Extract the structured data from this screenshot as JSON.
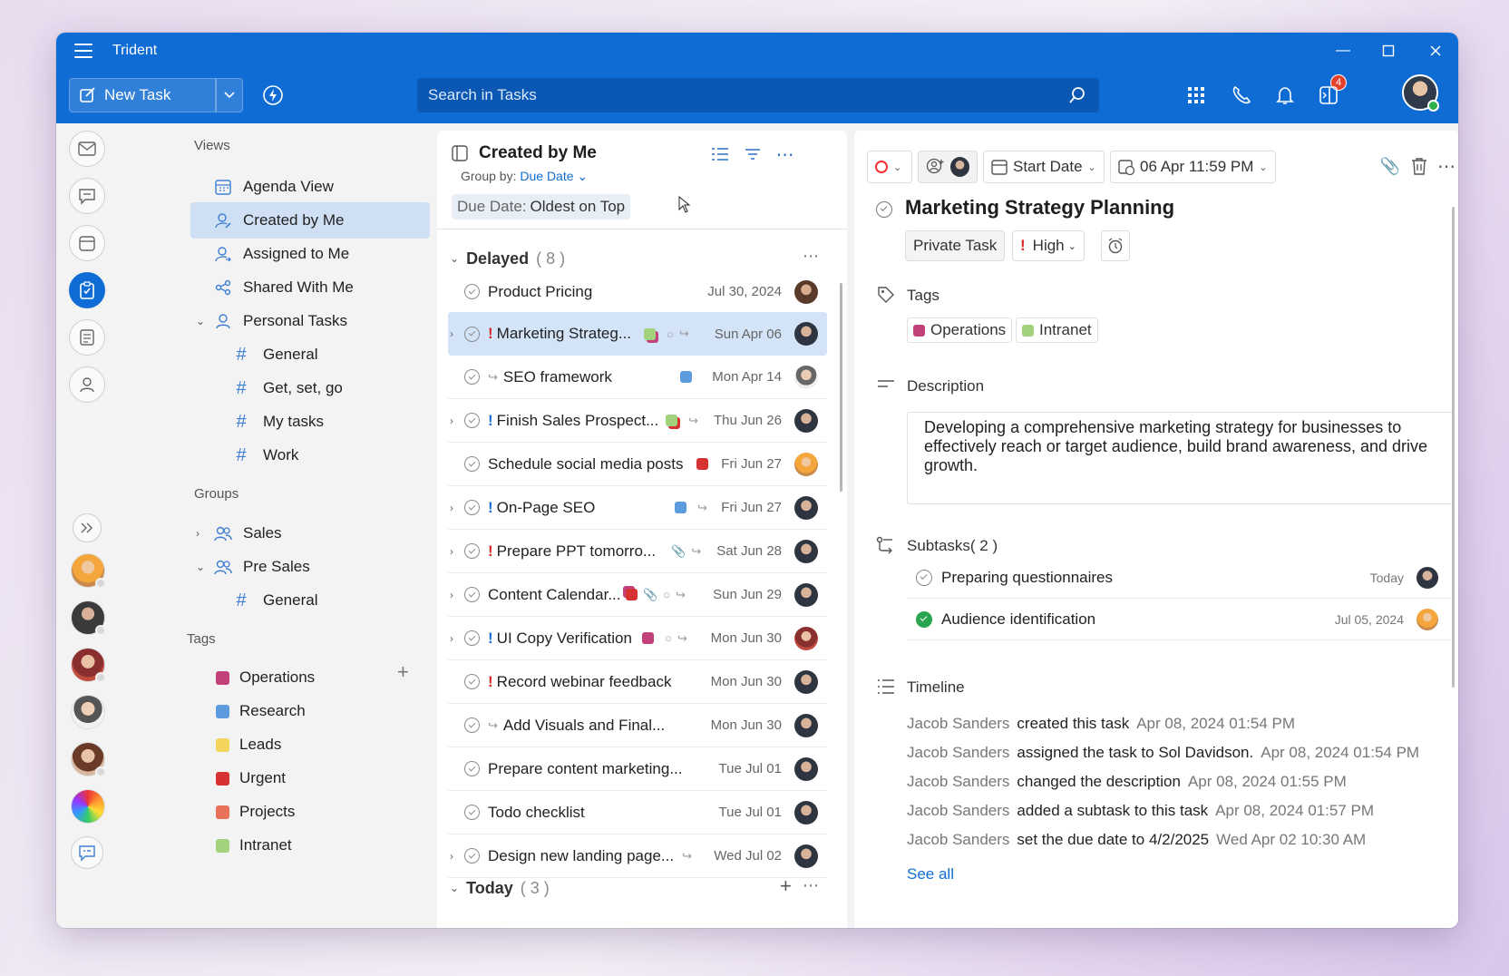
{
  "app": {
    "title": "Trident"
  },
  "toolbar": {
    "new_task": "New Task",
    "search_placeholder": "Search in Tasks",
    "notif_count": "4"
  },
  "sidebar": {
    "views_title": "Views",
    "views": [
      {
        "label": "Agenda View"
      },
      {
        "label": "Created by Me"
      },
      {
        "label": "Assigned to Me"
      },
      {
        "label": "Shared With Me"
      },
      {
        "label": "Personal Tasks"
      }
    ],
    "personal_sub": [
      "General",
      "Get, set, go",
      "My tasks",
      "Work"
    ],
    "groups_title": "Groups",
    "groups": [
      {
        "label": "Sales"
      },
      {
        "label": "Pre Sales"
      }
    ],
    "presales_sub": [
      "General"
    ],
    "tags_title": "Tags",
    "tags": [
      {
        "label": "Operations",
        "color": "#c2417b"
      },
      {
        "label": "Research",
        "color": "#5b9bde"
      },
      {
        "label": "Leads",
        "color": "#f2d55a"
      },
      {
        "label": "Urgent",
        "color": "#d63232"
      },
      {
        "label": "Projects",
        "color": "#e8715c"
      },
      {
        "label": "Intranet",
        "color": "#a3d27d"
      }
    ]
  },
  "list": {
    "title": "Created by Me",
    "groupby_label": "Group by:",
    "groupby_value": "Due Date",
    "sort_label": "Due Date:",
    "sort_value": "Oldest on Top",
    "groups": [
      {
        "name": "Delayed",
        "count": "( 8 )"
      },
      {
        "name": "Today",
        "count": "( 3 )"
      }
    ],
    "tasks": [
      {
        "title": "Product Pricing",
        "date": "Jul 30, 2024"
      },
      {
        "title": "Marketing Strateg...",
        "date": "Sun Apr 06"
      },
      {
        "title": "SEO framework",
        "date": "Mon Apr 14"
      },
      {
        "title": "Finish Sales Prospect...",
        "date": "Thu Jun 26"
      },
      {
        "title": "Schedule social media posts",
        "date": "Fri Jun 27"
      },
      {
        "title": "On-Page SEO",
        "date": "Fri Jun 27"
      },
      {
        "title": "Prepare PPT tomorro...",
        "date": "Sat Jun 28"
      },
      {
        "title": "Content Calendar...",
        "date": "Sun Jun 29"
      },
      {
        "title": "UI Copy Verification",
        "date": "Mon Jun 30"
      },
      {
        "title": "Record webinar feedback",
        "date": "Mon Jun 30"
      },
      {
        "title": "Add Visuals and Final...",
        "date": "Mon Jun 30"
      },
      {
        "title": "Prepare content marketing...",
        "date": "Tue Jul 01"
      },
      {
        "title": "Todo checklist",
        "date": "Tue Jul 01"
      },
      {
        "title": "Design new landing page...",
        "date": "Wed Jul 02"
      }
    ]
  },
  "detail": {
    "start_date": "Start Date",
    "due": "06 Apr 11:59 PM",
    "title": "Marketing Strategy Planning",
    "private": "Private Task",
    "priority": "High",
    "tags_label": "Tags",
    "tags": [
      "Operations",
      "Intranet"
    ],
    "description_label": "Description",
    "description": "Developing a comprehensive marketing strategy for businesses to effectively reach or target audience, build brand awareness, and drive growth.",
    "subtasks_label": "Subtasks( 2 )",
    "subtasks": [
      {
        "title": "Preparing questionnaires",
        "date": "Today"
      },
      {
        "title": "Audience identification",
        "date": "Jul 05, 2024"
      }
    ],
    "timeline_label": "Timeline",
    "timeline": [
      {
        "who": "Jacob Sanders",
        "what": "created this task",
        "when": "Apr 08, 2024 01:54 PM"
      },
      {
        "who": "Jacob Sanders",
        "what": "assigned the task to Sol Davidson.",
        "when": "Apr 08, 2024 01:54 PM"
      },
      {
        "who": "Jacob Sanders",
        "what": "changed the description",
        "when": "Apr 08, 2024 01:55 PM"
      },
      {
        "who": "Jacob Sanders",
        "what": "added a subtask to this task",
        "when": "Apr 08, 2024 01:57 PM"
      },
      {
        "who": "Jacob Sanders",
        "what": "set the due date to 4/2/2025",
        "when": "Wed Apr 02 10:30 AM"
      }
    ],
    "see_all": "See all"
  }
}
